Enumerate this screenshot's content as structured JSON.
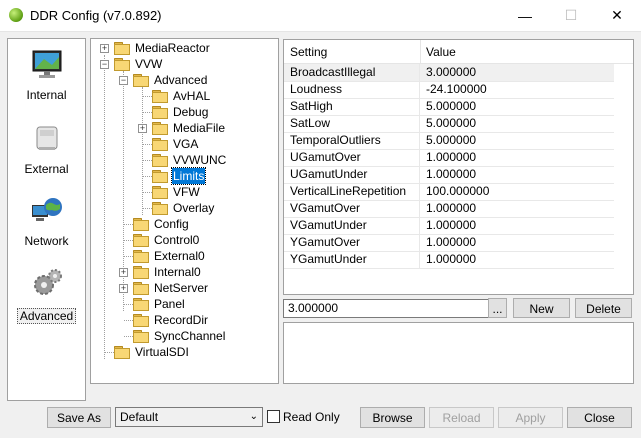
{
  "window": {
    "title": "DDR Config (v7.0.892)",
    "minimize_glyph": "—",
    "maximize_glyph": "☐",
    "close_glyph": "✕",
    "icon": "app-icon"
  },
  "nav": {
    "items": [
      {
        "label": "Internal",
        "icon": "monitor-icon"
      },
      {
        "label": "External",
        "icon": "device-icon"
      },
      {
        "label": "Network",
        "icon": "network-globe-icon"
      },
      {
        "label": "Advanced",
        "icon": "gears-icon"
      }
    ],
    "selected": "Advanced"
  },
  "tree": {
    "nodes": [
      {
        "label": "MediaReactor"
      },
      {
        "label": "VVW"
      },
      {
        "label": "Advanced"
      },
      {
        "label": "AvHAL"
      },
      {
        "label": "Debug"
      },
      {
        "label": "MediaFile"
      },
      {
        "label": "VGA"
      },
      {
        "label": "VVWUNC"
      },
      {
        "label": "Limits"
      },
      {
        "label": "VFW"
      },
      {
        "label": "Overlay"
      },
      {
        "label": "Config"
      },
      {
        "label": "Control0"
      },
      {
        "label": "External0"
      },
      {
        "label": "Internal0"
      },
      {
        "label": "NetServer"
      },
      {
        "label": "Panel"
      },
      {
        "label": "RecordDir"
      },
      {
        "label": "SyncChannel"
      },
      {
        "label": "VirtualSDI"
      }
    ],
    "selected": "Limits"
  },
  "grid": {
    "columns": [
      "Setting",
      "Value"
    ],
    "rows": [
      [
        "BroadcastIllegal",
        "3.000000"
      ],
      [
        "Loudness",
        "-24.100000"
      ],
      [
        "SatHigh",
        "5.000000"
      ],
      [
        "SatLow",
        "5.000000"
      ],
      [
        "TemporalOutliers",
        "5.000000"
      ],
      [
        "UGamutOver",
        "1.000000"
      ],
      [
        "UGamutUnder",
        "1.000000"
      ],
      [
        "VerticalLineRepetition",
        "100.000000"
      ],
      [
        "VGamutOver",
        "1.000000"
      ],
      [
        "VGamutUnder",
        "1.000000"
      ],
      [
        "YGamutOver",
        "1.000000"
      ],
      [
        "YGamutUnder",
        "1.000000"
      ]
    ]
  },
  "editor": {
    "value": "3.000000",
    "browse_label": "...",
    "new_label": "New",
    "delete_label": "Delete"
  },
  "footer": {
    "save_as_label": "Save As",
    "profile_value": "Default",
    "read_only_label": "Read Only",
    "read_only_checked": false,
    "browse_label": "Browse",
    "reload_label": "Reload",
    "apply_label": "Apply",
    "close_label": "Close"
  }
}
